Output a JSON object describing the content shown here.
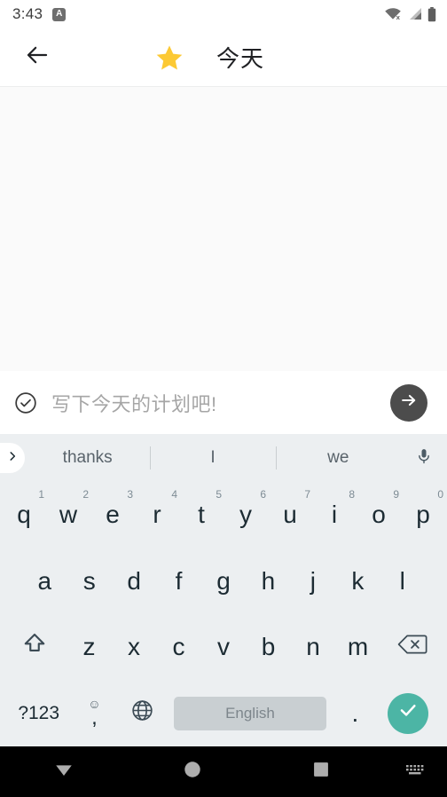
{
  "status_bar": {
    "time": "3:43",
    "app_badge_letter": "A",
    "icons": [
      "wifi-off-icon",
      "cellular-signal-icon",
      "battery-icon"
    ]
  },
  "app_bar": {
    "back_icon": "arrow-left-icon",
    "star_icon": "star-icon",
    "star_color": "#FCC934",
    "title": "今天"
  },
  "content": {
    "background": "#FAFAFA",
    "items": []
  },
  "input_bar": {
    "check_icon": "check-circle-icon",
    "placeholder": "写下今天的计划吧!",
    "value": "",
    "send_icon": "arrow-right-icon",
    "send_button_color": "#4C4C4C"
  },
  "keyboard": {
    "background": "#ECEFF1",
    "expand_icon": "chevron-right-icon",
    "suggestions": [
      "thanks",
      "I",
      "we"
    ],
    "mic_icon": "microphone-icon",
    "rows": [
      {
        "name": "row-1",
        "keys": [
          {
            "label": "q",
            "num": "1"
          },
          {
            "label": "w",
            "num": "2"
          },
          {
            "label": "e",
            "num": "3"
          },
          {
            "label": "r",
            "num": "4"
          },
          {
            "label": "t",
            "num": "5"
          },
          {
            "label": "y",
            "num": "6"
          },
          {
            "label": "u",
            "num": "7"
          },
          {
            "label": "i",
            "num": "8"
          },
          {
            "label": "o",
            "num": "9"
          },
          {
            "label": "p",
            "num": "0"
          }
        ]
      },
      {
        "name": "row-2",
        "keys": [
          {
            "label": "a"
          },
          {
            "label": "s"
          },
          {
            "label": "d"
          },
          {
            "label": "f"
          },
          {
            "label": "g"
          },
          {
            "label": "h"
          },
          {
            "label": "j"
          },
          {
            "label": "k"
          },
          {
            "label": "l"
          }
        ]
      },
      {
        "name": "row-3",
        "keys": [
          {
            "label": "z"
          },
          {
            "label": "x"
          },
          {
            "label": "c"
          },
          {
            "label": "v"
          },
          {
            "label": "b"
          },
          {
            "label": "n"
          },
          {
            "label": "m"
          }
        ],
        "shift_icon": "shift-icon",
        "backspace_icon": "backspace-icon"
      }
    ],
    "bottom_row": {
      "symbols_label": "?123",
      "emoji_icon": "emoji-smiley-icon",
      "comma_label": ",",
      "globe_icon": "globe-language-icon",
      "spacebar_label": "English",
      "period_label": ".",
      "enter_icon": "check-icon",
      "enter_button_color": "#4CB5A5"
    }
  },
  "nav_bar": {
    "background": "#000000",
    "back_icon": "triangle-down-icon",
    "home_icon": "circle-home-icon",
    "recents_icon": "square-recents-icon",
    "keyboard_icon": "keyboard-indicator-icon"
  }
}
